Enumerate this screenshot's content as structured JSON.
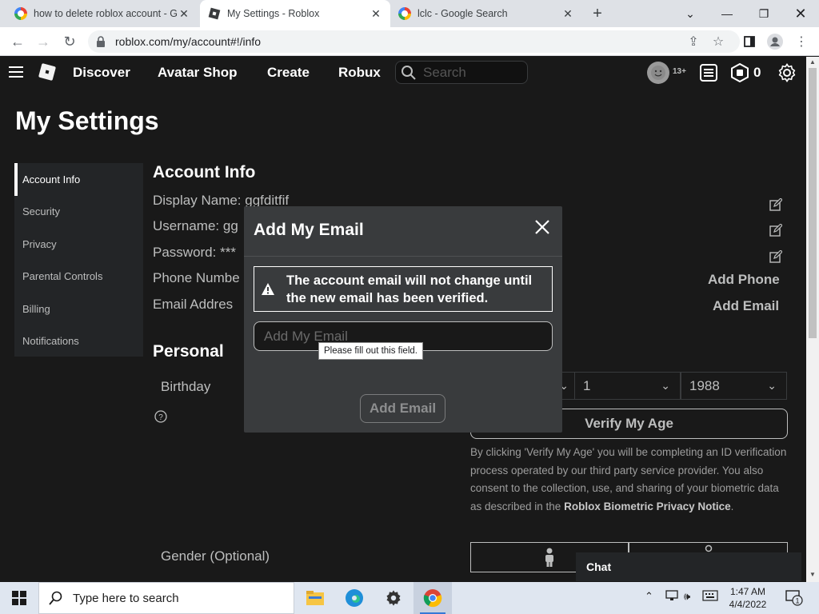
{
  "browser": {
    "tabs": [
      {
        "title": "how to delete roblox account - G",
        "favicon": "google-g-icon",
        "active": false
      },
      {
        "title": "My Settings - Roblox",
        "favicon": "roblox-icon",
        "active": true
      },
      {
        "title": "lclc - Google Search",
        "favicon": "google-g-icon",
        "active": false
      }
    ],
    "new_tab_label": "+",
    "url": "roblox.com/my/account#!/info"
  },
  "header": {
    "nav": [
      "Discover",
      "Avatar Shop",
      "Create",
      "Robux"
    ],
    "search_placeholder": "Search",
    "age_badge": "13+",
    "robux_count": "0"
  },
  "page": {
    "title": "My Settings",
    "sidebar": [
      {
        "label": "Account Info",
        "active": true
      },
      {
        "label": "Security",
        "active": false
      },
      {
        "label": "Privacy",
        "active": false
      },
      {
        "label": "Parental Controls",
        "active": false
      },
      {
        "label": "Billing",
        "active": false
      },
      {
        "label": "Notifications",
        "active": false
      }
    ],
    "account_info": {
      "heading": "Account Info",
      "display_name": "Display Name: ggfditfif",
      "username": "Username: gg",
      "password": "Password: ***",
      "phone": "Phone Numbe",
      "email": "Email Addres",
      "add_phone": "Add Phone",
      "add_email": "Add Email"
    },
    "personal": {
      "heading": "Personal",
      "birthday_label": "Birthday",
      "day": "1",
      "year": "1988",
      "verify_button": "Verify My Age",
      "verify_text_1": "By clicking 'Verify My Age' you will be completing an ID verification process operated by our third party service provider. You also consent to the collection, use, and sharing of your biometric data as described in the ",
      "verify_link": "Roblox Biometric Privacy Notice",
      "verify_text_2": ".",
      "gender_label": "Gender (Optional)"
    },
    "chat_label": "Chat"
  },
  "modal": {
    "title": "Add My Email",
    "warning": "The account email will not change until the new email has been verified.",
    "input_placeholder": "Add My Email",
    "input_value": "",
    "validation_tooltip": "Please fill out this field.",
    "submit_label": "Add Email"
  },
  "taskbar": {
    "search_placeholder": "Type here to search",
    "apps": [
      "file-explorer-icon",
      "edge-icon",
      "settings-icon",
      "chrome-icon"
    ],
    "time": "1:47 AM",
    "date": "4/4/2022",
    "notification_count": "1"
  }
}
